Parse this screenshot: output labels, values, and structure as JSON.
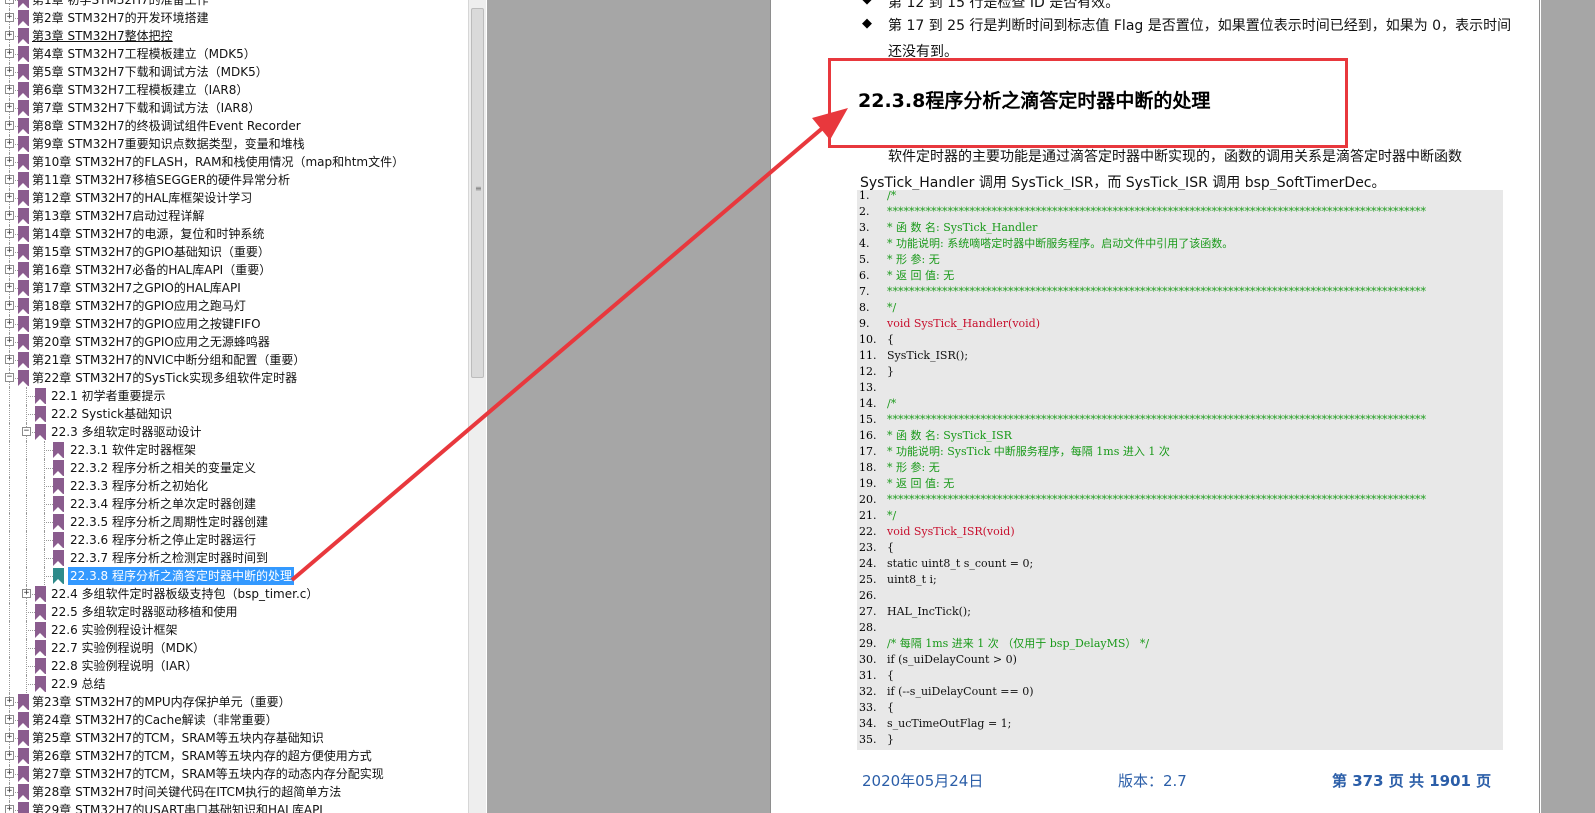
{
  "bookmarks": [
    {
      "label": "第1章 初学STM32H7的准备工作",
      "level": 0,
      "expander": "+"
    },
    {
      "label": "第2章 STM32H7的开发环境搭建",
      "level": 0,
      "expander": "+"
    },
    {
      "label": "第3章 STM32H7整体把控",
      "level": 0,
      "expander": "+",
      "underline": true
    },
    {
      "label": "第4章 STM32H7工程模板建立（MDK5）",
      "level": 0,
      "expander": "+"
    },
    {
      "label": "第5章 STM32H7下载和调试方法（MDK5）",
      "level": 0,
      "expander": "+"
    },
    {
      "label": "第6章 STM32H7工程模板建立（IAR8）",
      "level": 0,
      "expander": "+"
    },
    {
      "label": "第7章 STM32H7下载和调试方法（IAR8）",
      "level": 0,
      "expander": "+"
    },
    {
      "label": "第8章 STM32H7的终极调试组件Event Recorder",
      "level": 0,
      "expander": "+"
    },
    {
      "label": "第9章 STM32H7重要知识点数据类型，变量和堆栈",
      "level": 0,
      "expander": "+"
    },
    {
      "label": "第10章 STM32H7的FLASH，RAM和栈使用情况（map和htm文件）",
      "level": 0,
      "expander": "+"
    },
    {
      "label": "第11章 STM32H7移植SEGGER的硬件异常分析",
      "level": 0,
      "expander": "+"
    },
    {
      "label": "第12章 STM32H7的HAL库框架设计学习",
      "level": 0,
      "expander": "+"
    },
    {
      "label": "第13章 STM32H7启动过程详解",
      "level": 0,
      "expander": "+"
    },
    {
      "label": "第14章 STM32H7的电源，复位和时钟系统",
      "level": 0,
      "expander": "+"
    },
    {
      "label": "第15章 STM32H7的GPIO基础知识（重要）",
      "level": 0,
      "expander": "+"
    },
    {
      "label": "第16章 STM32H7必备的HAL库API（重要）",
      "level": 0,
      "expander": "+"
    },
    {
      "label": "第17章 STM32H7之GPIO的HAL库API",
      "level": 0,
      "expander": "+"
    },
    {
      "label": "第18章 STM32H7的GPIO应用之跑马灯",
      "level": 0,
      "expander": "+"
    },
    {
      "label": "第19章 STM32H7的GPIO应用之按键FIFO",
      "level": 0,
      "expander": "+"
    },
    {
      "label": "第20章 STM32H7的GPIO应用之无源蜂鸣器",
      "level": 0,
      "expander": "+"
    },
    {
      "label": "第21章 STM32H7的NVIC中断分组和配置（重要）",
      "level": 0,
      "expander": "+"
    },
    {
      "label": "第22章 STM32H7的SysTick实现多组软件定时器",
      "level": 0,
      "expander": "-"
    },
    {
      "label": "22.1 初学者重要提示",
      "level": 1,
      "expander": ""
    },
    {
      "label": "22.2 Systick基础知识",
      "level": 1,
      "expander": ""
    },
    {
      "label": "22.3 多组软定时器驱动设计",
      "level": 1,
      "expander": "-"
    },
    {
      "label": "22.3.1 软件定时器框架",
      "level": 2,
      "expander": ""
    },
    {
      "label": "22.3.2 程序分析之相关的变量定义",
      "level": 2,
      "expander": ""
    },
    {
      "label": "22.3.3 程序分析之初始化",
      "level": 2,
      "expander": ""
    },
    {
      "label": "22.3.4 程序分析之单次定时器创建",
      "level": 2,
      "expander": ""
    },
    {
      "label": "22.3.5 程序分析之周期性定时器创建",
      "level": 2,
      "expander": ""
    },
    {
      "label": "22.3.6 程序分析之停止定时器运行",
      "level": 2,
      "expander": ""
    },
    {
      "label": "22.3.7 程序分析之检测定时器时间到",
      "level": 2,
      "expander": ""
    },
    {
      "label": "22.3.8 程序分析之滴答定时器中断的处理",
      "level": 2,
      "expander": "",
      "selected": true
    },
    {
      "label": "22.4 多组软件定时器板级支持包（bsp_timer.c）",
      "level": 1,
      "expander": "+"
    },
    {
      "label": "22.5 多组软定时器驱动移植和使用",
      "level": 1,
      "expander": ""
    },
    {
      "label": "22.6 实验例程设计框架",
      "level": 1,
      "expander": ""
    },
    {
      "label": "22.7 实验例程说明（MDK）",
      "level": 1,
      "expander": ""
    },
    {
      "label": "22.8 实验例程说明（IAR）",
      "level": 1,
      "expander": ""
    },
    {
      "label": "22.9 总结",
      "level": 1,
      "expander": ""
    },
    {
      "label": "第23章 STM32H7的MPU内存保护单元（重要）",
      "level": 0,
      "expander": "+"
    },
    {
      "label": "第24章 STM32H7的Cache解读（非常重要）",
      "level": 0,
      "expander": "+"
    },
    {
      "label": "第25章 STM32H7的TCM，SRAM等五块内存基础知识",
      "level": 0,
      "expander": "+"
    },
    {
      "label": "第26章 STM32H7的TCM，SRAM等五块内存的超方便使用方式",
      "level": 0,
      "expander": "+"
    },
    {
      "label": "第27章 STM32H7的TCM，SRAM等五块内存的动态内存分配实现",
      "level": 0,
      "expander": "+"
    },
    {
      "label": "第28章 STM32H7时间关键代码在ITCM执行的超简单方法",
      "level": 0,
      "expander": "+"
    },
    {
      "label": "第29章 STM32H7的USART串口基础知识和HAL库API",
      "level": 0,
      "expander": "+"
    }
  ],
  "document": {
    "bullet_top": "第 12 到 15 行是检查 ID 是否有效。",
    "bullet_main_1": "第 17 到 25 行是判断时间到标志值 Flag 是否置位，如果置位表示时间已经到，如果为 0，表示时间",
    "bullet_main_2": "还没有到。",
    "heading": "22.3.8程序分析之滴答定时器中断的处理",
    "para_1": "软件定时器的主要功能是通过滴答定时器中断实现的，函数的调用关系是滴答定时器中断函数",
    "para_2": "SysTick_Handler 调用 SysTick_ISR，而 SysTick_ISR 调用 bsp_SoftTimerDec。",
    "code": [
      {
        "n": "1.",
        "t": "/*",
        "c": "green"
      },
      {
        "n": "2.",
        "t": "**************************************************************************************************",
        "c": "green"
      },
      {
        "n": "3.",
        "t": "*   函 数 名: SysTick_Handler",
        "c": "green"
      },
      {
        "n": "4.",
        "t": "*   功能说明: 系统嘀嗒定时器中断服务程序。启动文件中引用了该函数。",
        "c": "green"
      },
      {
        "n": "5.",
        "t": "*   形    参: 无",
        "c": "green"
      },
      {
        "n": "6.",
        "t": "*   返 回 值: 无",
        "c": "green"
      },
      {
        "n": "7.",
        "t": "**************************************************************************************************",
        "c": "green"
      },
      {
        "n": "8.",
        "t": "*/",
        "c": "green"
      },
      {
        "n": "9.",
        "t": "void SysTick_Handler(void)",
        "c": "red"
      },
      {
        "n": "10.",
        "t": "{",
        "c": "black"
      },
      {
        "n": "11.",
        "t": "    SysTick_ISR();",
        "c": "black"
      },
      {
        "n": "12.",
        "t": "}",
        "c": "black"
      },
      {
        "n": "13.",
        "t": "",
        "c": "black"
      },
      {
        "n": "14.",
        "t": "/*",
        "c": "green"
      },
      {
        "n": "15.",
        "t": "**************************************************************************************************",
        "c": "green"
      },
      {
        "n": "16.",
        "t": "*   函 数 名: SysTick_ISR",
        "c": "green"
      },
      {
        "n": "17.",
        "t": "*   功能说明: SysTick 中断服务程序，每隔 1ms 进入 1 次",
        "c": "green"
      },
      {
        "n": "18.",
        "t": "*   形    参: 无",
        "c": "green"
      },
      {
        "n": "19.",
        "t": "*   返 回 值: 无",
        "c": "green"
      },
      {
        "n": "20.",
        "t": "**************************************************************************************************",
        "c": "green"
      },
      {
        "n": "21.",
        "t": "*/",
        "c": "green"
      },
      {
        "n": "22.",
        "t": "void SysTick_ISR(void)",
        "c": "red"
      },
      {
        "n": "23.",
        "t": "{",
        "c": "black"
      },
      {
        "n": "24.",
        "t": "    static uint8_t s_count = 0;",
        "c": "black"
      },
      {
        "n": "25.",
        "t": "    uint8_t i;",
        "c": "black"
      },
      {
        "n": "26.",
        "t": "",
        "c": "black"
      },
      {
        "n": "27.",
        "t": "    HAL_IncTick();",
        "c": "black"
      },
      {
        "n": "28.",
        "t": "",
        "c": "black"
      },
      {
        "n": "29.",
        "t": "    /* 每隔 1ms 进来 1 次 （仅用于 bsp_DelayMS） */",
        "c": "green"
      },
      {
        "n": "30.",
        "t": "    if (s_uiDelayCount > 0)",
        "c": "black"
      },
      {
        "n": "31.",
        "t": "    {",
        "c": "black"
      },
      {
        "n": "32.",
        "t": "        if (--s_uiDelayCount == 0)",
        "c": "black"
      },
      {
        "n": "33.",
        "t": "        {",
        "c": "black"
      },
      {
        "n": "34.",
        "t": "            s_ucTimeOutFlag = 1;",
        "c": "black"
      },
      {
        "n": "35.",
        "t": "        }",
        "c": "black"
      }
    ],
    "footer_date": "2020年05月24日",
    "footer_version": "版本：2.7",
    "footer_page": "第  373  页  共  1901  页"
  },
  "colors": {
    "selection": "#3399ff",
    "bookmark_icon": "#8a5c8e",
    "highlight_box": "#e8383d",
    "code_comment": "#1a9a1a",
    "code_keyword": "#c8102e",
    "footer_text": "#2b5ea8"
  }
}
